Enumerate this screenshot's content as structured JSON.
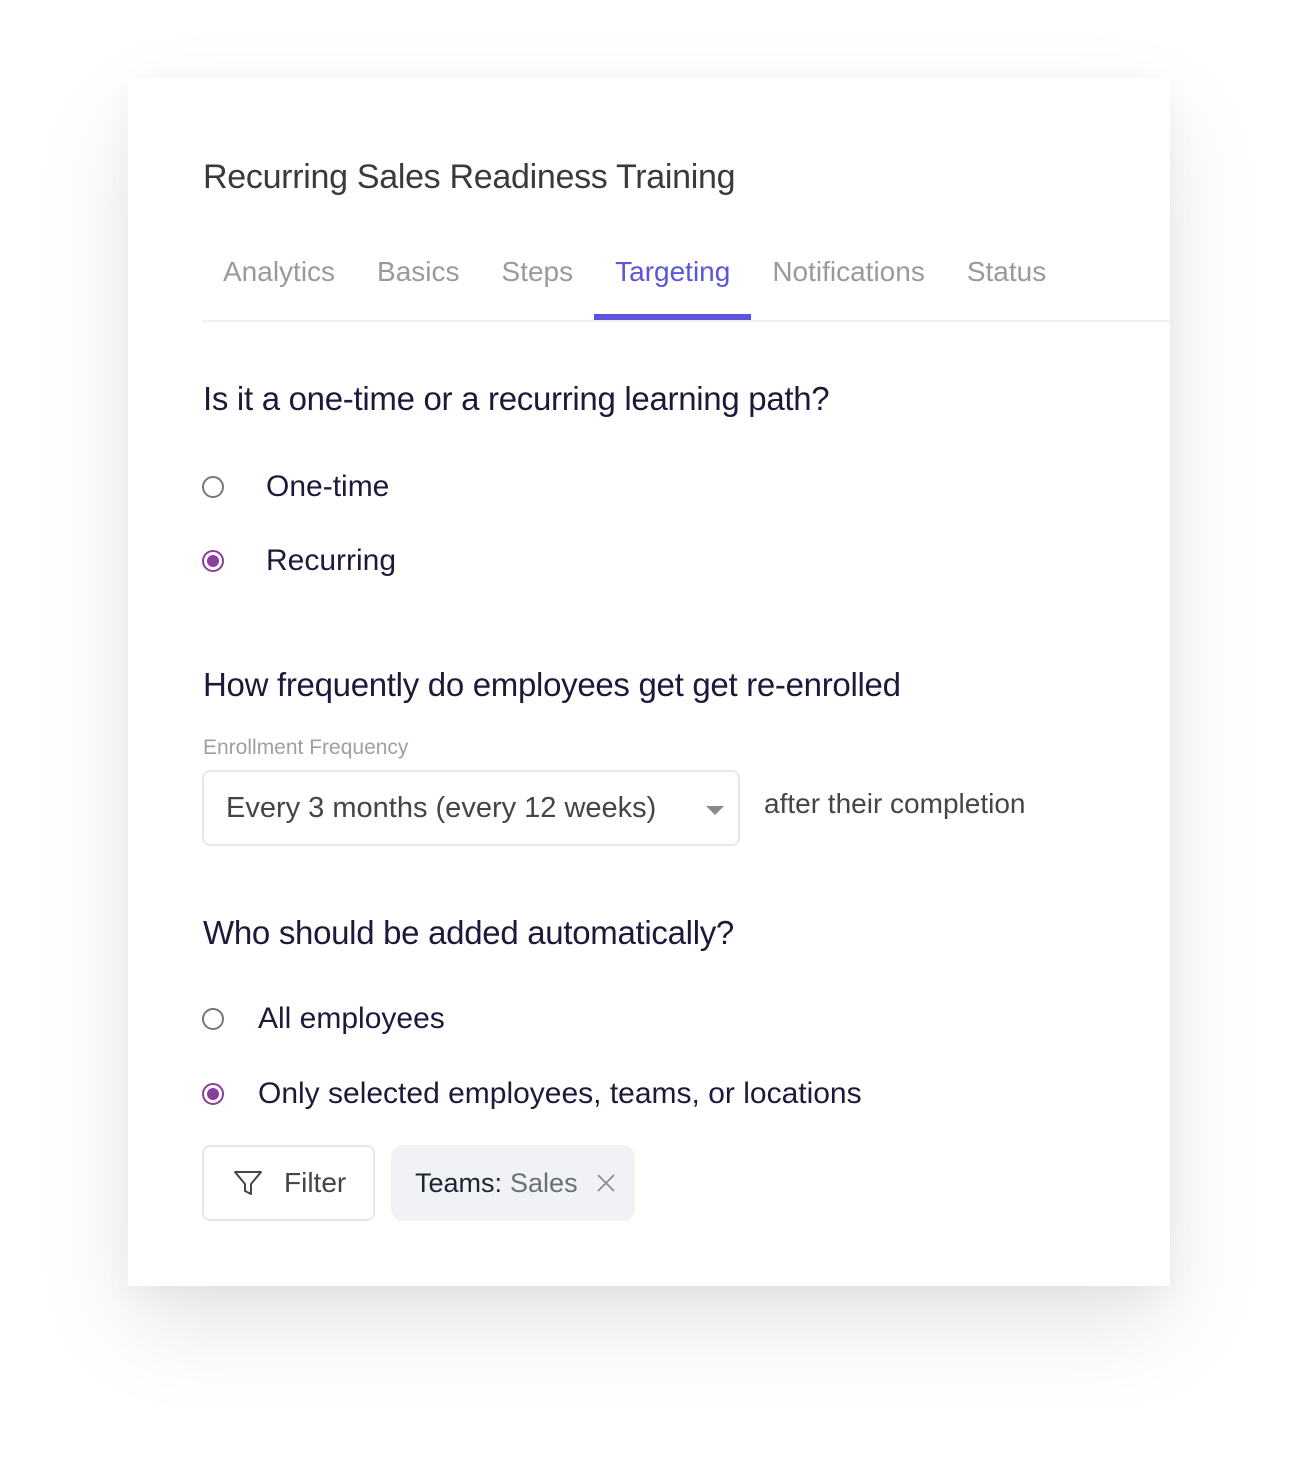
{
  "page": {
    "title": "Recurring Sales Readiness Training"
  },
  "tabs": [
    {
      "label": "Analytics",
      "active": false
    },
    {
      "label": "Basics",
      "active": false
    },
    {
      "label": "Steps",
      "active": false
    },
    {
      "label": "Targeting",
      "active": true
    },
    {
      "label": "Notifications",
      "active": false
    },
    {
      "label": "Status",
      "active": false
    }
  ],
  "accent_color": "#5b55de",
  "radio_color": "#8b3f9c",
  "path_type": {
    "question": "Is it a one-time or a recurring learning path?",
    "options": [
      {
        "label": "One-time",
        "checked": false
      },
      {
        "label": "Recurring",
        "checked": true
      }
    ]
  },
  "frequency": {
    "question": "How frequently do employees get get re-enrolled",
    "field_label": "Enrollment Frequency",
    "selected_value": "Every 3 months (every 12 weeks)",
    "suffix_text": "after their completion"
  },
  "audience": {
    "question": "Who should be added automatically?",
    "options": [
      {
        "label": "All employees",
        "checked": false
      },
      {
        "label": "Only selected employees, teams, or locations",
        "checked": true
      }
    ],
    "filter_button_label": "Filter",
    "filter_icon": "funnel-icon",
    "chips": [
      {
        "key": "Teams:",
        "value": "Sales",
        "close_icon": "close-icon"
      }
    ]
  }
}
